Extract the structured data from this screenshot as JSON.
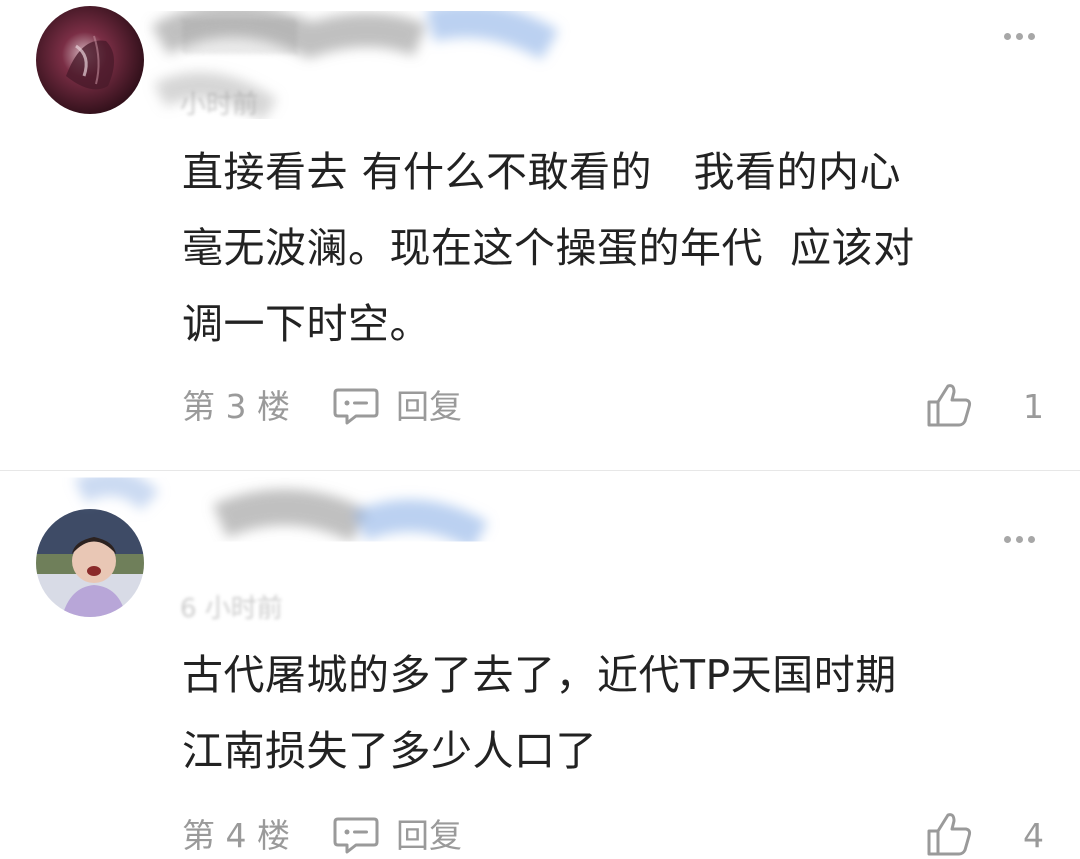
{
  "comments": [
    {
      "username": "▒▒▒▒▒",
      "time": "小时前",
      "text": "直接看去 有什么不敢看的　我看的内心\n毫无波澜。现在这个操蛋的年代  应该对\n调一下时空。",
      "floor": "第 3 楼",
      "reply_label": "回复",
      "likes": "1",
      "icons": {
        "more": "more-dots-icon",
        "reply": "comment-bubble-icon",
        "like": "thumbs-up-icon"
      }
    },
    {
      "username": "▒▒▒▒▒▒",
      "time": "6 小时前",
      "text": "古代屠城的多了去了，近代TP天国时期\n江南损失了多少人口了",
      "floor": "第 4 楼",
      "reply_label": "回复",
      "likes": "4",
      "icons": {
        "more": "more-dots-icon",
        "reply": "comment-bubble-icon",
        "like": "thumbs-up-icon"
      }
    }
  ],
  "colors": {
    "text": "#222222",
    "meta": "#9a9a9a",
    "divider": "#e7e7e7",
    "background": "#ffffff"
  }
}
